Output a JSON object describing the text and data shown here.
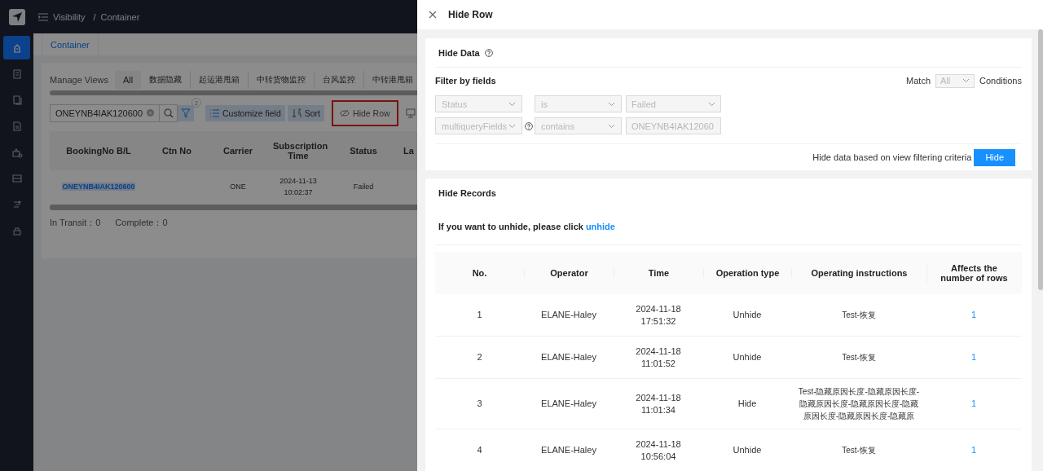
{
  "app": {
    "breadcrumb": [
      "Visibility",
      "Container"
    ],
    "breadcrumb_separator": "/",
    "sidebar": [
      {
        "selected": true
      },
      {
        "selected": false
      },
      {
        "selected": false
      },
      {
        "selected": false
      },
      {
        "selected": false
      },
      {
        "selected": false
      },
      {
        "selected": false
      },
      {
        "selected": false
      }
    ],
    "page_tab": "Container",
    "views": {
      "manage_label": "Manage Views",
      "tabs": [
        {
          "label": "All",
          "selected": true
        },
        {
          "label": "数据隐藏",
          "selected": false
        },
        {
          "label": "起运港甩箱",
          "selected": false
        },
        {
          "label": "中转货物监控",
          "selected": false
        },
        {
          "label": "台风监控",
          "selected": false
        },
        {
          "label": "中转港甩箱",
          "selected": false
        }
      ]
    },
    "toolbar": {
      "search_value": "ONEYNB4IAK120600",
      "filter_badge": "2",
      "buttons": [
        {
          "label": "Customize field",
          "kind": "customize",
          "highlighted": false
        },
        {
          "label": "Sort",
          "kind": "sort",
          "highlighted": false
        },
        {
          "label": "Hide Row",
          "kind": "hide",
          "highlighted": true
        }
      ]
    },
    "table": {
      "columns": [
        "BookingNo B/L",
        "Ctn No",
        "Carrier",
        "Subscription Time",
        "Status",
        "La"
      ],
      "rows": [
        {
          "booking": "ONEYNB4IAK120600",
          "carrier": "ONE",
          "time": "2024-11-13 10:02:37",
          "status": "Failed"
        }
      ]
    },
    "footer": [
      "In Transit：0",
      "Complete：0"
    ]
  },
  "drawer": {
    "title": "Hide Row",
    "hide_data": {
      "title": "Hide Data",
      "filter_label": "Filter by fields",
      "match_label": "Match",
      "match_value": "All",
      "conditions_label": "Conditions",
      "filters": [
        {
          "field": "Status",
          "help": false,
          "operator": "is",
          "value": "Failed",
          "disabled": true
        },
        {
          "field": "multiqueryFields",
          "help": true,
          "operator": "contains",
          "value": "ONEYNB4IAK12060",
          "disabled": true
        }
      ],
      "hint": "Hide data based on view filtering criteria",
      "button": "Hide"
    },
    "hide_records": {
      "title": "Hide Records",
      "note": "If you want to unhide, please click",
      "link": "unhide",
      "columns": [
        "No.",
        "Operator",
        "Time",
        "Operation type",
        "Operating instructions",
        "Affects the number of rows"
      ],
      "rows": [
        {
          "no": "1",
          "operator": "ELANE-Haley",
          "time": "2024-11-18 17:51:32",
          "type": "Unhide",
          "instructions": "Test-恢复",
          "rows": "1"
        },
        {
          "no": "2",
          "operator": "ELANE-Haley",
          "time": "2024-11-18 11:01:52",
          "type": "Unhide",
          "instructions": "Test-恢复",
          "rows": "1"
        },
        {
          "no": "3",
          "operator": "ELANE-Haley",
          "time": "2024-11-18 11:01:34",
          "type": "Hide",
          "instructions": "Test-隐藏原因长度-隐藏原因长度-隐藏原因长度-隐藏原因长度-隐藏原因长度-隐藏原因长度-隐藏原",
          "rows": "1"
        },
        {
          "no": "4",
          "operator": "ELANE-Haley",
          "time": "2024-11-18 10:56:04",
          "type": "Unhide",
          "instructions": "Test-恢复",
          "rows": "1"
        }
      ]
    }
  }
}
